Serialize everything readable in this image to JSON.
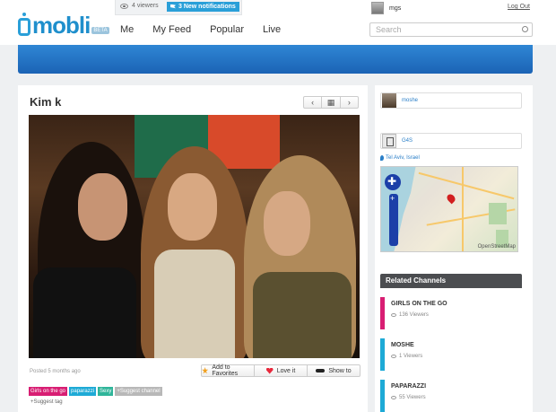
{
  "header": {
    "logo": "mobli",
    "logo_badge": "BETA",
    "viewers": "4 viewers",
    "notifications": "3 New notifications",
    "username": "mgs",
    "logout": "Log Out",
    "nav": [
      "Me",
      "My Feed",
      "Popular",
      "Live"
    ],
    "search_placeholder": "Search"
  },
  "media": {
    "title": "Kim k",
    "posted": "Posted 5 months ago",
    "actions": [
      "Add to Favorites",
      "Love it",
      "Show to"
    ],
    "tags": [
      "Girls on the go",
      "paparazzi",
      "Sexy",
      "+Suggest channel"
    ],
    "suggest_tag": "+Suggest tag"
  },
  "sidebar": {
    "user": "moshe",
    "channel": "G4S",
    "location": "Tel Aviv, Israel",
    "map_credit": "OpenStreetMap",
    "related_title": "Related Channels",
    "channels": [
      {
        "name": "GIRLS ON THE GO",
        "viewers": "136 Viewers",
        "color": "#d81e73"
      },
      {
        "name": "MOSHE",
        "viewers": "1 Viewers",
        "color": "#1eaad6"
      },
      {
        "name": "PAPARAZZI",
        "viewers": "55 Viewers",
        "color": "#1eaad6"
      }
    ]
  }
}
